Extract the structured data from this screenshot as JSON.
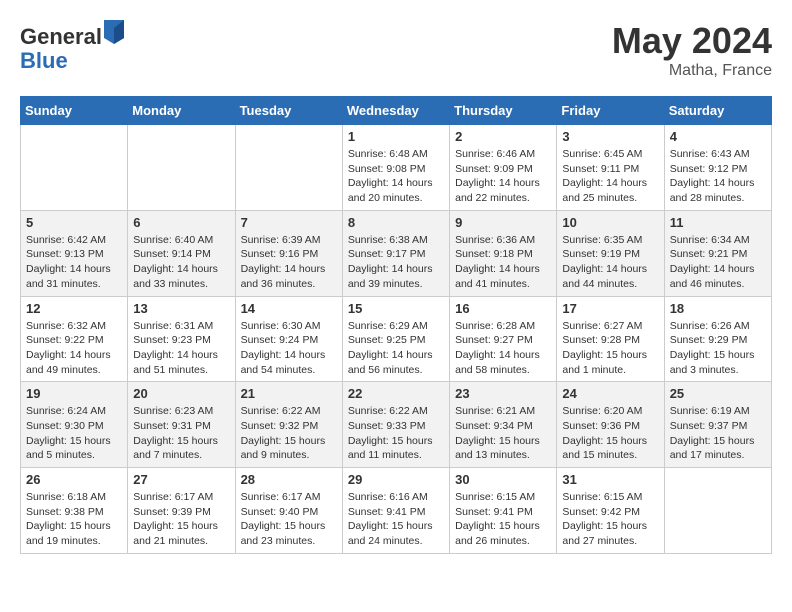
{
  "logo": {
    "general": "General",
    "blue": "Blue"
  },
  "title": {
    "month_year": "May 2024",
    "location": "Matha, France"
  },
  "calendar": {
    "headers": [
      "Sunday",
      "Monday",
      "Tuesday",
      "Wednesday",
      "Thursday",
      "Friday",
      "Saturday"
    ],
    "rows": [
      [
        {
          "day": "",
          "info": ""
        },
        {
          "day": "",
          "info": ""
        },
        {
          "day": "",
          "info": ""
        },
        {
          "day": "1",
          "info": "Sunrise: 6:48 AM\nSunset: 9:08 PM\nDaylight: 14 hours\nand 20 minutes."
        },
        {
          "day": "2",
          "info": "Sunrise: 6:46 AM\nSunset: 9:09 PM\nDaylight: 14 hours\nand 22 minutes."
        },
        {
          "day": "3",
          "info": "Sunrise: 6:45 AM\nSunset: 9:11 PM\nDaylight: 14 hours\nand 25 minutes."
        },
        {
          "day": "4",
          "info": "Sunrise: 6:43 AM\nSunset: 9:12 PM\nDaylight: 14 hours\nand 28 minutes."
        }
      ],
      [
        {
          "day": "5",
          "info": "Sunrise: 6:42 AM\nSunset: 9:13 PM\nDaylight: 14 hours\nand 31 minutes."
        },
        {
          "day": "6",
          "info": "Sunrise: 6:40 AM\nSunset: 9:14 PM\nDaylight: 14 hours\nand 33 minutes."
        },
        {
          "day": "7",
          "info": "Sunrise: 6:39 AM\nSunset: 9:16 PM\nDaylight: 14 hours\nand 36 minutes."
        },
        {
          "day": "8",
          "info": "Sunrise: 6:38 AM\nSunset: 9:17 PM\nDaylight: 14 hours\nand 39 minutes."
        },
        {
          "day": "9",
          "info": "Sunrise: 6:36 AM\nSunset: 9:18 PM\nDaylight: 14 hours\nand 41 minutes."
        },
        {
          "day": "10",
          "info": "Sunrise: 6:35 AM\nSunset: 9:19 PM\nDaylight: 14 hours\nand 44 minutes."
        },
        {
          "day": "11",
          "info": "Sunrise: 6:34 AM\nSunset: 9:21 PM\nDaylight: 14 hours\nand 46 minutes."
        }
      ],
      [
        {
          "day": "12",
          "info": "Sunrise: 6:32 AM\nSunset: 9:22 PM\nDaylight: 14 hours\nand 49 minutes."
        },
        {
          "day": "13",
          "info": "Sunrise: 6:31 AM\nSunset: 9:23 PM\nDaylight: 14 hours\nand 51 minutes."
        },
        {
          "day": "14",
          "info": "Sunrise: 6:30 AM\nSunset: 9:24 PM\nDaylight: 14 hours\nand 54 minutes."
        },
        {
          "day": "15",
          "info": "Sunrise: 6:29 AM\nSunset: 9:25 PM\nDaylight: 14 hours\nand 56 minutes."
        },
        {
          "day": "16",
          "info": "Sunrise: 6:28 AM\nSunset: 9:27 PM\nDaylight: 14 hours\nand 58 minutes."
        },
        {
          "day": "17",
          "info": "Sunrise: 6:27 AM\nSunset: 9:28 PM\nDaylight: 15 hours\nand 1 minute."
        },
        {
          "day": "18",
          "info": "Sunrise: 6:26 AM\nSunset: 9:29 PM\nDaylight: 15 hours\nand 3 minutes."
        }
      ],
      [
        {
          "day": "19",
          "info": "Sunrise: 6:24 AM\nSunset: 9:30 PM\nDaylight: 15 hours\nand 5 minutes."
        },
        {
          "day": "20",
          "info": "Sunrise: 6:23 AM\nSunset: 9:31 PM\nDaylight: 15 hours\nand 7 minutes."
        },
        {
          "day": "21",
          "info": "Sunrise: 6:22 AM\nSunset: 9:32 PM\nDaylight: 15 hours\nand 9 minutes."
        },
        {
          "day": "22",
          "info": "Sunrise: 6:22 AM\nSunset: 9:33 PM\nDaylight: 15 hours\nand 11 minutes."
        },
        {
          "day": "23",
          "info": "Sunrise: 6:21 AM\nSunset: 9:34 PM\nDaylight: 15 hours\nand 13 minutes."
        },
        {
          "day": "24",
          "info": "Sunrise: 6:20 AM\nSunset: 9:36 PM\nDaylight: 15 hours\nand 15 minutes."
        },
        {
          "day": "25",
          "info": "Sunrise: 6:19 AM\nSunset: 9:37 PM\nDaylight: 15 hours\nand 17 minutes."
        }
      ],
      [
        {
          "day": "26",
          "info": "Sunrise: 6:18 AM\nSunset: 9:38 PM\nDaylight: 15 hours\nand 19 minutes."
        },
        {
          "day": "27",
          "info": "Sunrise: 6:17 AM\nSunset: 9:39 PM\nDaylight: 15 hours\nand 21 minutes."
        },
        {
          "day": "28",
          "info": "Sunrise: 6:17 AM\nSunset: 9:40 PM\nDaylight: 15 hours\nand 23 minutes."
        },
        {
          "day": "29",
          "info": "Sunrise: 6:16 AM\nSunset: 9:41 PM\nDaylight: 15 hours\nand 24 minutes."
        },
        {
          "day": "30",
          "info": "Sunrise: 6:15 AM\nSunset: 9:41 PM\nDaylight: 15 hours\nand 26 minutes."
        },
        {
          "day": "31",
          "info": "Sunrise: 6:15 AM\nSunset: 9:42 PM\nDaylight: 15 hours\nand 27 minutes."
        },
        {
          "day": "",
          "info": ""
        }
      ]
    ]
  }
}
